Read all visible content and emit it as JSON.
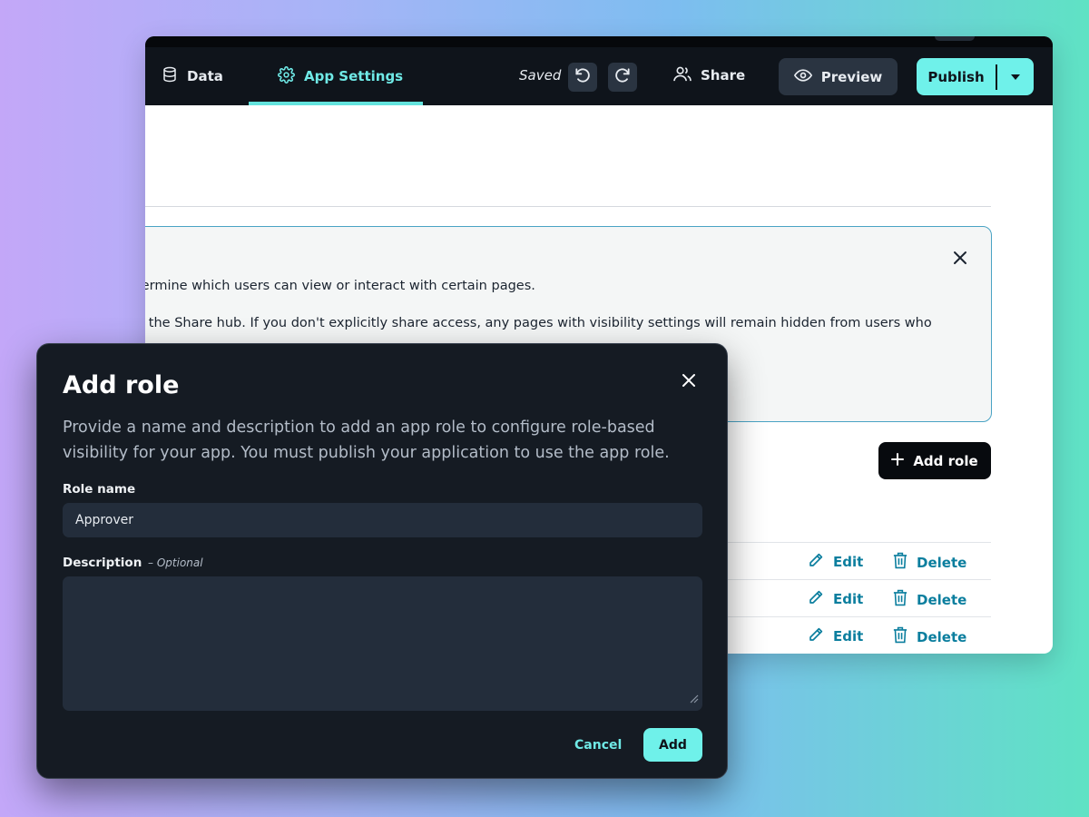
{
  "topbar": {
    "tabs": [
      {
        "label": "Data",
        "icon": "database-icon",
        "active": false
      },
      {
        "label": "App Settings",
        "icon": "gear-icon",
        "active": true
      }
    ],
    "saved_label": "Saved",
    "share_label": "Share",
    "preview_label": "Preview",
    "publish_label": "Publish"
  },
  "info_panel": {
    "line1": "termine which users can view or interact with certain pages.",
    "line2": "n the Share hub. If you don't explicitly share access, any pages with visibility settings will remain hidden from users who"
  },
  "add_role_button": "Add role",
  "role_rows": [
    {
      "edit": "Edit",
      "delete": "Delete"
    },
    {
      "edit": "Edit",
      "delete": "Delete"
    },
    {
      "edit": "Edit",
      "delete": "Delete"
    }
  ],
  "modal": {
    "title": "Add role",
    "description": "Provide a name and description to add an app role to configure role-based visibility for your app. You must publish your application to use the app role.",
    "role_name_label": "Role name",
    "role_name_value": "Approver",
    "description_label": "Description",
    "optional_label": "– Optional",
    "cancel_label": "Cancel",
    "add_label": "Add"
  },
  "colors": {
    "accent": "#6ff1ea",
    "link": "#0b7e9e",
    "modal_bg": "#151b23",
    "topbar_bg": "#0f141b"
  }
}
